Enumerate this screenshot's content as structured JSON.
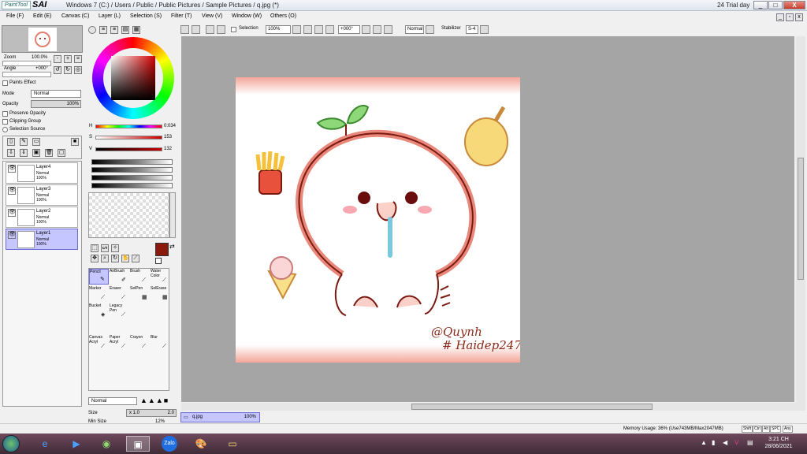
{
  "titlebar": {
    "logo_text": "PaintTool",
    "logo_sai": "SAI",
    "title": "Windows 7 (C:) / Users / Public / Public Pictures / Sample Pictures / q.jpg (*)",
    "trial": "24 Trial day",
    "min": "_",
    "max": "□",
    "close": "X"
  },
  "menu": [
    "File (F)",
    "Edit (E)",
    "Canvas (C)",
    "Layer (L)",
    "Selection (S)",
    "Filter (T)",
    "View (V)",
    "Window (W)",
    "Others (O)"
  ],
  "navigator": {
    "zoom_label": "Zoom",
    "zoom_value": "100.0%",
    "angle_label": "Angle",
    "angle_value": "+000°"
  },
  "layer_props": {
    "paper_effect": "Paints Effect",
    "mode_label": "Mode",
    "mode_value": "Normal",
    "opacity_label": "Opacity",
    "opacity_value": "100%",
    "preserve_opacity": "Preserve Opacity",
    "clipping_group": "Clipping Group",
    "selection_source": "Selection Source"
  },
  "layers": [
    {
      "name": "Layer4",
      "mode": "Normal",
      "opacity": "100%"
    },
    {
      "name": "Layer3",
      "mode": "Normal",
      "opacity": "100%"
    },
    {
      "name": "Layer2",
      "mode": "Normal",
      "opacity": "100%"
    },
    {
      "name": "Layer1",
      "mode": "Normal",
      "opacity": "100%"
    }
  ],
  "color": {
    "h_label": "H",
    "h_value": "0:034",
    "s_label": "S",
    "s_value": "153",
    "v_label": "V",
    "v_value": "132",
    "primary": "#8b1a0c"
  },
  "tools": [
    {
      "name": "Pencil",
      "icon": "pencil-icon"
    },
    {
      "name": "AirBrush",
      "icon": "airbrush-icon"
    },
    {
      "name": "Brush",
      "icon": "brush-icon"
    },
    {
      "name": "Water Color",
      "icon": "watercolor-icon"
    },
    {
      "name": "Marker",
      "icon": "marker-icon"
    },
    {
      "name": "Eraser",
      "icon": "eraser-icon"
    },
    {
      "name": "SelPen",
      "icon": "selpen-icon"
    },
    {
      "name": "SelErase",
      "icon": "selerase-icon"
    },
    {
      "name": "Bucket",
      "icon": "bucket-icon"
    },
    {
      "name": "Legacy Pen",
      "icon": "legacy-pen-icon"
    },
    {
      "name": "Canvas Acryl",
      "icon": "acrylic-icon"
    },
    {
      "name": "Paper Acryl",
      "icon": "acrylic-icon"
    },
    {
      "name": "Crayon",
      "icon": "crayon-icon"
    },
    {
      "name": "Blur",
      "icon": "blur-icon"
    }
  ],
  "brush": {
    "mode": "Normal",
    "size_label": "Size",
    "size_mult": "x 1.0",
    "size_value": "2.0",
    "minsize_label": "Min Size",
    "minsize_value": "12%"
  },
  "canvas_toolbar": {
    "selection_label": "Selection",
    "zoom": "100%",
    "angle": "+000°",
    "mode": "Normal",
    "stabilizer_label": "Stabilizer",
    "stabilizer_value": "S-4"
  },
  "doc_tab": {
    "name": "q.jpg",
    "zoom": "100%"
  },
  "status": {
    "memory": "Memory Usage: 36% (Use743MB/Max2047MB)",
    "keys": [
      "Shift",
      "Ctrl",
      "Alt",
      "SPC",
      "Any"
    ]
  },
  "artwork": {
    "signature": "@Quynh",
    "hashtag": "# Haidep247"
  },
  "taskbar": {
    "time": "3:21 CH",
    "date": "28/06/2021",
    "zalo": "Zalo"
  }
}
